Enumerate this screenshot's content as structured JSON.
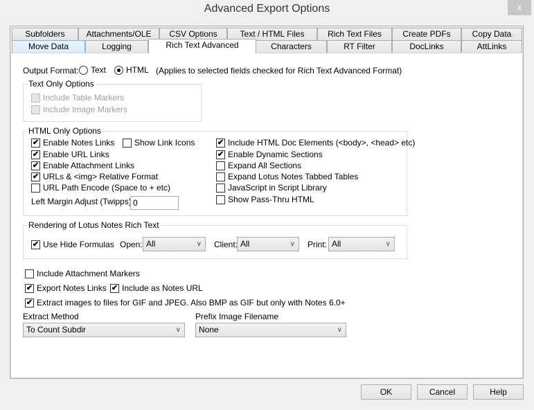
{
  "window": {
    "title": "Advanced Export Options",
    "close": "x"
  },
  "tabs_row1": [
    "Subfolders",
    "Attachments/OLE",
    "CSV Options",
    "Text / HTML Files",
    "Rich Text Files",
    "Create PDFs",
    "Copy Data"
  ],
  "tabs_row2": [
    "Move Data",
    "Logging",
    "Rich Text Advanced",
    "Characters",
    "RT Filter",
    "DocLinks",
    "AttLinks"
  ],
  "active_tab": "Rich Text Advanced",
  "output_format": {
    "label": "Output Format:",
    "options": [
      "Text",
      "HTML"
    ],
    "selected": "HTML",
    "note": "(Applies to selected fields checked for Rich Text Advanced Format)"
  },
  "text_only": {
    "title": "Text Only Options",
    "items": [
      {
        "label": "Include Table Markers",
        "checked": false,
        "disabled": true
      },
      {
        "label": "Include Image Markers",
        "checked": false,
        "disabled": true
      }
    ]
  },
  "html_only": {
    "title": "HTML Only Options",
    "items": [
      {
        "label": "Enable Notes Links",
        "checked": true
      },
      {
        "label": "Show Link Icons",
        "checked": false
      },
      {
        "label": "Enable URL Links",
        "checked": true
      },
      {
        "label": "Enable Attachment Links",
        "checked": true
      },
      {
        "label": "URLs & <img> Relative Format",
        "checked": true
      },
      {
        "label": "URL Path Encode (Space to + etc)",
        "checked": false
      },
      {
        "label": "Include HTML Doc Elements (<body>, <head> etc)",
        "checked": true
      },
      {
        "label": "Enable Dynamic Sections",
        "checked": true
      },
      {
        "label": "Expand All Sections",
        "checked": false
      },
      {
        "label": "Expand Lotus Notes Tabbed Tables",
        "checked": false
      },
      {
        "label": "JavaScript in Script Library",
        "checked": false
      },
      {
        "label": "Show Pass-Thru HTML",
        "checked": false
      }
    ],
    "margin_label": "Left Margin Adjust (Twipps):",
    "margin_value": "0"
  },
  "rendering": {
    "title": "Rendering of Lotus Notes Rich Text",
    "use_hide": {
      "label": "Use Hide Formulas",
      "checked": true
    },
    "open_label": "Open:",
    "open_value": "All",
    "client_label": "Client:",
    "client_value": "All",
    "print_label": "Print:",
    "print_value": "All"
  },
  "bottom": {
    "items": [
      {
        "label": "Include Attachment Markers",
        "checked": false
      },
      {
        "label": "Export Notes Links",
        "checked": true
      },
      {
        "label": "Include as Notes URL",
        "checked": true
      },
      {
        "label": "Extract images to files for GIF and JPEG. Also BMP as GIF but only with Notes 6.0+",
        "checked": true
      }
    ],
    "extract_label": "Extract Method",
    "extract_value": "To Count Subdir",
    "prefix_label": "Prefix Image Filename",
    "prefix_value": "None"
  },
  "buttons": {
    "ok": "OK",
    "cancel": "Cancel",
    "help": "Help"
  }
}
